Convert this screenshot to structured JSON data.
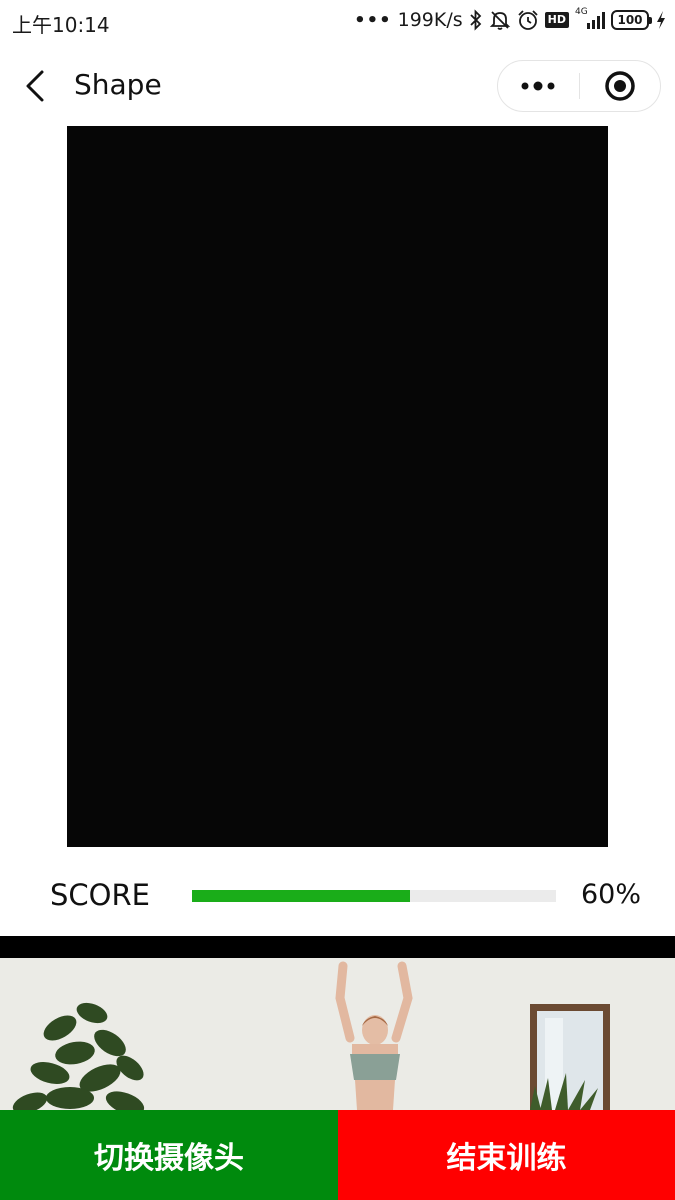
{
  "status_bar": {
    "time": "上午10:14",
    "network_speed": "199K/s",
    "network_type": "4G",
    "battery": "100",
    "icons": [
      "signal-dots-icon",
      "bluetooth-icon",
      "alarm-off-icon",
      "alarm-clock-icon",
      "hd-icon",
      "cellular-signal-icon",
      "battery-icon",
      "charging-icon"
    ]
  },
  "nav": {
    "title": "Shape",
    "back_icon": "chevron-left-icon",
    "more_icon": "more-dots-icon",
    "close_icon": "target-circle-icon"
  },
  "score": {
    "label": "SCORE",
    "value": 0.6,
    "percent_text": "60%",
    "fill_color": "#1aad19",
    "track_color": "#ebebeb"
  },
  "buttons": {
    "switch_camera": "切换摄像头",
    "end_training": "结束训练",
    "switch_color": "#008a0d",
    "end_color": "#ff0000"
  }
}
